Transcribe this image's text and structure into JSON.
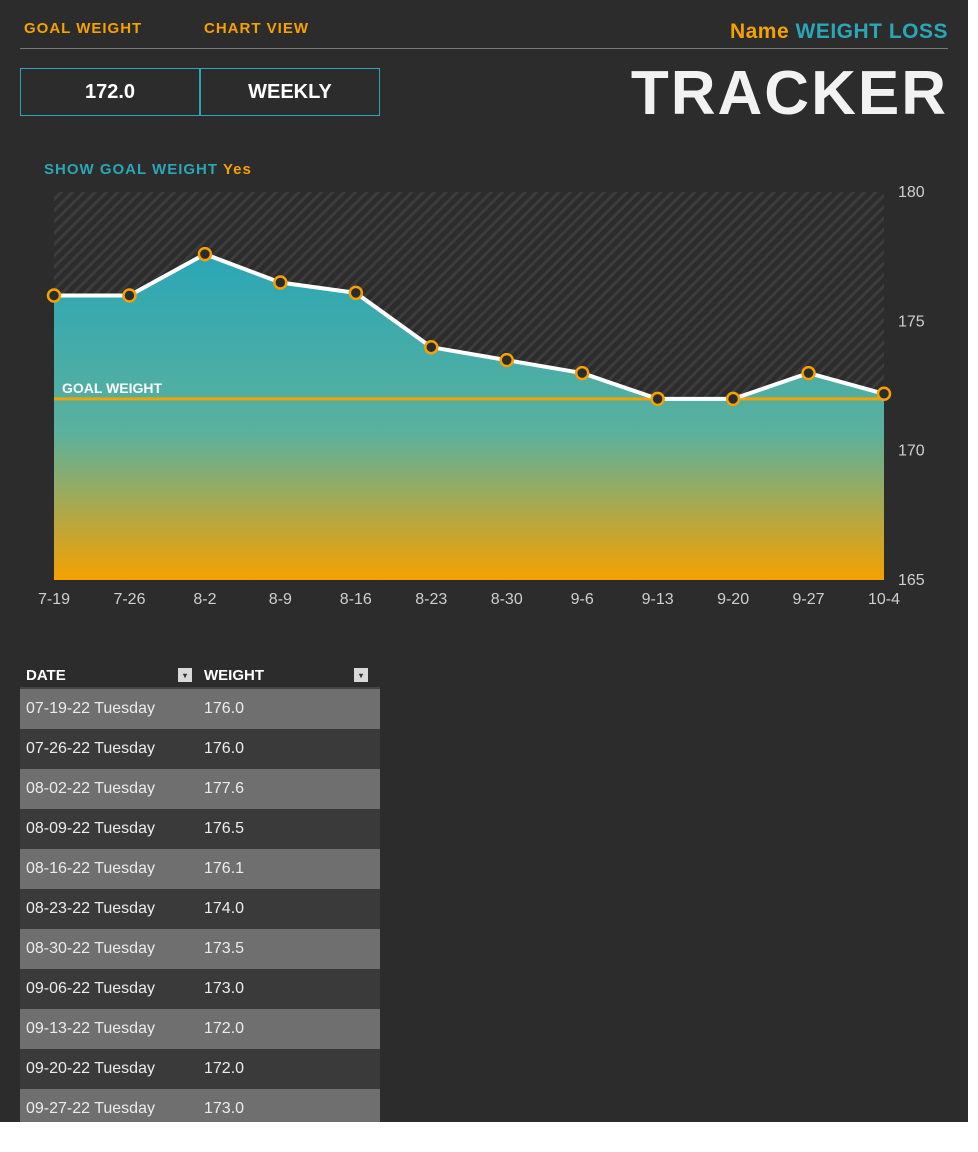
{
  "header": {
    "goal_weight_label": "GOAL WEIGHT",
    "chart_view_label": "CHART VIEW",
    "name_label": "Name",
    "name_value": "WEIGHT LOSS",
    "goal_weight_value": "172.0",
    "chart_view_value": "WEEKLY",
    "tracker_title": "TRACKER",
    "show_goal_label": "SHOW GOAL WEIGHT",
    "show_goal_value": "Yes"
  },
  "table": {
    "columns": {
      "date": "DATE",
      "weight": "WEIGHT"
    },
    "rows": [
      {
        "date": "07-19-22 Tuesday",
        "weight": "176.0"
      },
      {
        "date": "07-26-22 Tuesday",
        "weight": "176.0"
      },
      {
        "date": "08-02-22 Tuesday",
        "weight": "177.6"
      },
      {
        "date": "08-09-22 Tuesday",
        "weight": "176.5"
      },
      {
        "date": "08-16-22 Tuesday",
        "weight": "176.1"
      },
      {
        "date": "08-23-22 Tuesday",
        "weight": "174.0"
      },
      {
        "date": "08-30-22 Tuesday",
        "weight": "173.5"
      },
      {
        "date": "09-06-22 Tuesday",
        "weight": "173.0"
      },
      {
        "date": "09-13-22 Tuesday",
        "weight": "172.0"
      },
      {
        "date": "09-20-22 Tuesday",
        "weight": "172.0"
      },
      {
        "date": "09-27-22 Tuesday",
        "weight": "173.0"
      }
    ]
  },
  "chart_data": {
    "type": "area",
    "title": "",
    "xlabel": "",
    "ylabel": "",
    "ylim": [
      165,
      180
    ],
    "yticks": [
      165,
      170,
      175,
      180
    ],
    "goal_value": 172,
    "goal_label": "GOAL WEIGHT",
    "categories": [
      "7-19",
      "7-26",
      "8-2",
      "8-9",
      "8-16",
      "8-23",
      "8-30",
      "9-6",
      "9-13",
      "9-20",
      "9-27",
      "10-4"
    ],
    "series": [
      {
        "name": "Weight",
        "values": [
          176.0,
          176.0,
          177.6,
          176.5,
          176.1,
          174.0,
          173.5,
          173.0,
          172.0,
          172.0,
          173.0,
          172.2
        ]
      }
    ]
  }
}
